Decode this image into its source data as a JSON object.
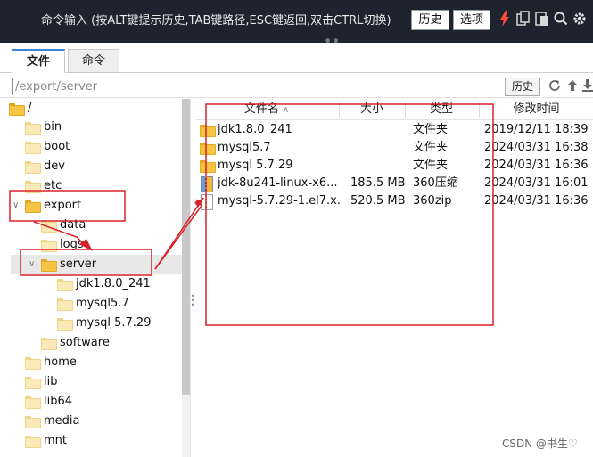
{
  "command_bar": {
    "prompt": "命令输入 (按ALT键提示历史,TAB键路径,ESC键返回,双击CTRL切换)",
    "history_label": "历史",
    "options_label": "选项",
    "icons": [
      "lightning-icon",
      "copy-icon",
      "paste-icon",
      "search-icon",
      "gear-icon"
    ]
  },
  "tabs": [
    {
      "label": "文件",
      "active": true
    },
    {
      "label": "命令",
      "active": false
    }
  ],
  "path_bar": {
    "value": "/export/server",
    "history_label": "历史",
    "icons": [
      "refresh-icon",
      "up-icon",
      "download-icon"
    ]
  },
  "tree": {
    "items": [
      {
        "label": "/",
        "depth": 0,
        "expanded": true
      },
      {
        "label": "bin",
        "depth": 1
      },
      {
        "label": "boot",
        "depth": 1
      },
      {
        "label": "dev",
        "depth": 1
      },
      {
        "label": "etc",
        "depth": 1
      },
      {
        "label": "export",
        "depth": 1,
        "expanded": true
      },
      {
        "label": "data",
        "depth": 2
      },
      {
        "label": "logs",
        "depth": 2
      },
      {
        "label": "server",
        "depth": 2,
        "expanded": true,
        "selected": true
      },
      {
        "label": "jdk1.8.0_241",
        "depth": 3
      },
      {
        "label": "mysql5.7",
        "depth": 3
      },
      {
        "label": "mysql 5.7.29",
        "depth": 3
      },
      {
        "label": "software",
        "depth": 2
      },
      {
        "label": "home",
        "depth": 1
      },
      {
        "label": "lib",
        "depth": 1
      },
      {
        "label": "lib64",
        "depth": 1
      },
      {
        "label": "media",
        "depth": 1
      },
      {
        "label": "mnt",
        "depth": 1
      }
    ]
  },
  "file_list": {
    "columns": {
      "name": "文件名",
      "size": "大小",
      "type": "类型",
      "modified": "修改时间"
    },
    "rows": [
      {
        "name": "jdk1.8.0_241",
        "size": "",
        "type": "文件夹",
        "modified": "2019/12/11 18:39",
        "icon": "folder-icon"
      },
      {
        "name": "mysql5.7",
        "size": "",
        "type": "文件夹",
        "modified": "2024/03/31 16:38",
        "icon": "folder-icon"
      },
      {
        "name": "mysql 5.7.29",
        "size": "",
        "type": "文件夹",
        "modified": "2024/03/31 16:36",
        "icon": "folder-icon"
      },
      {
        "name": "jdk-8u241-linux-x6...",
        "size": "185.5 MB",
        "type": "360压缩",
        "modified": "2024/03/31 16:01",
        "icon": "archive-icon"
      },
      {
        "name": "mysql-5.7.29-1.el7.x...",
        "size": "520.5 MB",
        "type": "360zip",
        "modified": "2024/03/31 16:36",
        "icon": "zip-file-icon"
      }
    ]
  },
  "watermark": "CSDN @书生♡",
  "colors": {
    "command_bar_bg": "#1d2430",
    "annotation_red": "#d9202a",
    "folder_yellow": "#f6c343",
    "tab_accent": "#3b84d6"
  }
}
